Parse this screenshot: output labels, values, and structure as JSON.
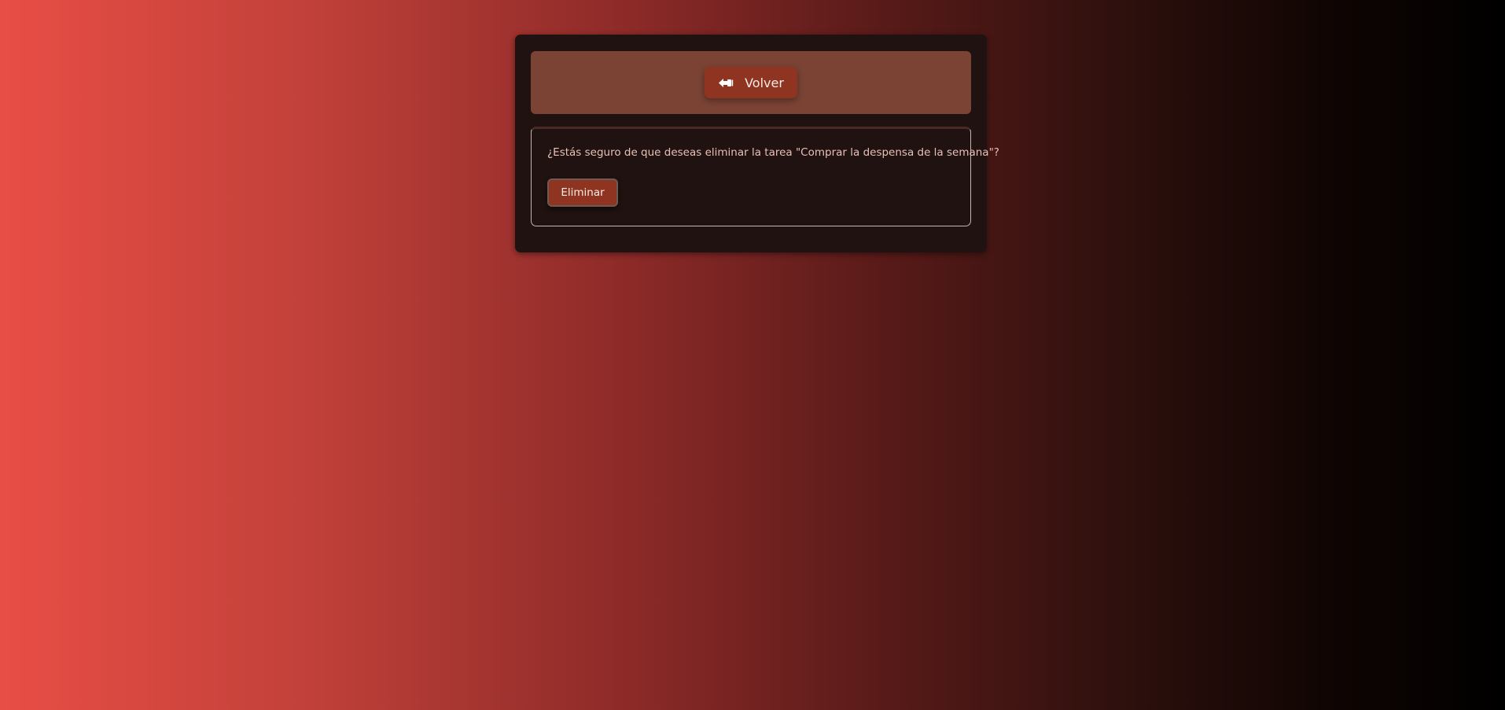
{
  "header": {
    "back_button": {
      "icon": "hand-pointing-left-icon",
      "label": "Volver"
    }
  },
  "confirmation": {
    "message": "¿Estás seguro de que deseas eliminar la tarea \"Comprar la despensa de la semana\"?",
    "delete_label": "Eliminar"
  },
  "colors": {
    "accent": "#8f3420",
    "card_background": "#1f1210",
    "header_panel": "#7a4334",
    "text_light": "#e9c1b5",
    "gradient_start": "#e84e45",
    "gradient_end": "#000000"
  }
}
